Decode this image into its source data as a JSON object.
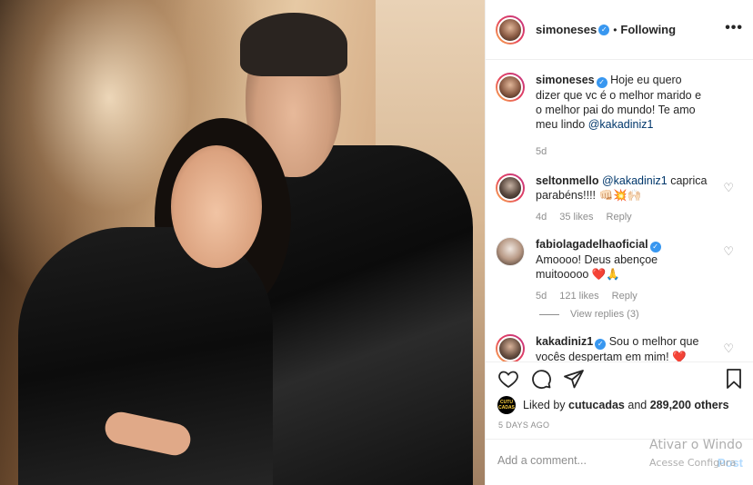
{
  "post": {
    "author": "simoneses",
    "follow_status": "Following",
    "more_label": "•••",
    "caption": {
      "username": "simoneses",
      "text": "Hoje eu quero dizer que vc é o melhor marido e o melhor pai do mundo! Te amo meu lindo",
      "mention": "@kakadiniz1",
      "age": "5d"
    }
  },
  "comments": [
    {
      "username": "seltonmello",
      "mention": "@kakadiniz1",
      "text": "caprica parabéns!!!! 👊🏻💥🙌🏻",
      "age": "4d",
      "likes": "35 likes",
      "reply": "Reply"
    },
    {
      "username": "fabiolagadelhaoficial",
      "text": "Amoooo! Deus abençoe muitooooo ❤️🙏",
      "age": "5d",
      "likes": "121 likes",
      "reply": "Reply",
      "view_replies": "View replies (3)"
    },
    {
      "username": "kakadiniz1",
      "text": "Sou o melhor que vocês despertam em mim! ❤️"
    }
  ],
  "likes": {
    "prefix": "Liked by",
    "first_liker": "cutucadas",
    "and": "and",
    "others": "289,200 others",
    "badge_text": "CUTU CADAS"
  },
  "time_ago": "5 DAYS AGO",
  "add_comment": {
    "placeholder": "Add a comment...",
    "post_label": "Post"
  },
  "watermark": {
    "line1": "Ativar o Windo",
    "line2": "Acesse Configura"
  }
}
